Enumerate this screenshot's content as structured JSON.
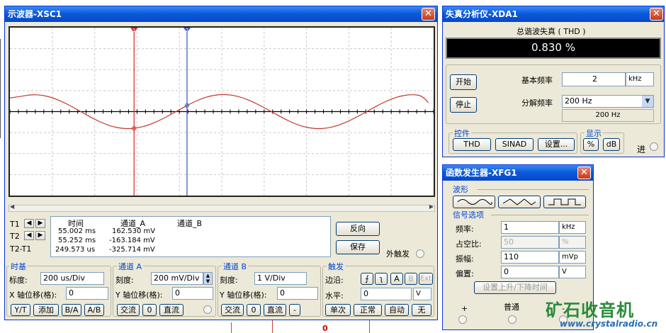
{
  "scope": {
    "title": "示波器-XSC1",
    "close": "✕",
    "cursor_labels": [
      "1",
      "2"
    ],
    "readout": {
      "headers": [
        "时间",
        "通道_A",
        "通道_B"
      ],
      "rows": [
        {
          "label": "T1",
          "time": "55.002 ms",
          "a": "162.530 mV",
          "b": ""
        },
        {
          "label": "T2",
          "time": "55.252 ms",
          "a": "-163.184 mV",
          "b": ""
        },
        {
          "label": "T2-T1",
          "time": "249.573 us",
          "a": "-325.714 mV",
          "b": ""
        }
      ]
    },
    "reverse_btn": "反向",
    "save_btn": "保存",
    "ext_trigger": "外触发",
    "timebase": {
      "title": "时基",
      "scale_label": "标度:",
      "scale": "200 us/Div",
      "xpos_label": "X 轴位移(格):",
      "xpos": "0",
      "buttons": [
        "Y/T",
        "添加",
        "B/A",
        "A/B"
      ]
    },
    "chA": {
      "title": "通道 A",
      "scale_label": "刻度:",
      "scale": "200 mV/Div",
      "ypos_label": "Y 轴位移(格):",
      "ypos": "0",
      "buttons": [
        "交流",
        "0",
        "直流"
      ]
    },
    "chB": {
      "title": "通道 B",
      "scale_label": "刻度:",
      "scale": "1  V/Div",
      "ypos_label": "Y 轴位移(格):",
      "ypos": "0",
      "buttons": [
        "交流",
        "0",
        "直流",
        "-"
      ]
    },
    "trigger": {
      "title": "触发",
      "edge_label": "边沿:",
      "edge_buttons": [
        "A",
        "B",
        "Ext"
      ],
      "level_label": "水平:",
      "level": "0",
      "level_unit": "V",
      "buttons": [
        "单次",
        "正常",
        "自动",
        "无"
      ]
    }
  },
  "dist": {
    "title": "失真分析仪-XDA1",
    "close": "✕",
    "label": "总谐波失真 ( THD )",
    "value": "0.830 %",
    "start_btn": "开始",
    "stop_btn": "停止",
    "fund_label": "基本频率",
    "fund_value": "2",
    "fund_unit": "kHz",
    "res_label": "分解频率",
    "res_value": "200 Hz",
    "res_display": "200 Hz",
    "controls_title": "控件",
    "controls": [
      "THD",
      "SINAD",
      "设置..."
    ],
    "display_title": "显示",
    "display": [
      "%",
      "dB"
    ],
    "in_label": "进"
  },
  "fg": {
    "title": "函数发生器-XFG1",
    "close": "✕",
    "waveform_title": "波形",
    "signal_title": "信号选项",
    "rows": [
      {
        "label": "频率:",
        "value": "1",
        "unit": "kHz"
      },
      {
        "label": "占空比:",
        "value": "50",
        "unit": "%"
      },
      {
        "label": "振幅:",
        "value": "110",
        "unit": "mVp"
      },
      {
        "label": "偏置:",
        "value": "0",
        "unit": "V"
      }
    ],
    "rise_btn": "设置上升/下降时间",
    "plus": "+",
    "common": "普通",
    "minus": "-"
  },
  "watermark": {
    "title": "矿石收音机",
    "url": "www.crystalradio.cn"
  },
  "canvas": {
    "marker": "0"
  },
  "chart_data": {
    "type": "line",
    "title": "",
    "xlabel": "",
    "ylabel": "",
    "grid": true,
    "x_units": "div",
    "y_units": "div",
    "xlim": [
      0,
      10
    ],
    "ylim": [
      -4,
      4
    ],
    "series": [
      {
        "x": [
          0,
          0.25,
          0.5,
          0.75,
          1,
          1.25,
          1.5,
          1.75,
          2,
          2.25,
          2.5,
          2.75,
          3,
          3.25,
          3.5,
          3.75,
          4,
          4.25,
          4.5,
          4.75,
          5,
          5.25,
          5.5,
          5.75,
          6,
          6.25,
          6.5,
          6.75,
          7,
          7.25,
          7.5,
          7.75,
          8,
          8.25,
          8.5,
          8.75,
          9,
          9.25,
          9.5,
          9.75,
          10
        ],
        "y": [
          0.65,
          0.72,
          0.81,
          0.79,
          0.67,
          0.46,
          0.2,
          -0.09,
          -0.37,
          -0.6,
          -0.76,
          -0.82,
          -0.79,
          -0.66,
          -0.45,
          -0.19,
          0.09,
          0.37,
          0.6,
          0.76,
          0.82,
          0.79,
          0.66,
          0.45,
          0.19,
          -0.09,
          -0.37,
          -0.6,
          -0.76,
          -0.82,
          -0.79,
          -0.66,
          -0.45,
          -0.19,
          0.09,
          0.37,
          0.6,
          0.76,
          0.82,
          0.75,
          0.1
        ]
      }
    ],
    "cursors": [
      {
        "label": "1",
        "x": 2.93
      },
      {
        "label": "2",
        "x": 4.18
      }
    ],
    "colors": {
      "trace": "#c0392b",
      "cursor1": "#e02020",
      "cursor2": "#3050c0",
      "grid": "#c8c8c8",
      "axis": "#000000"
    }
  }
}
